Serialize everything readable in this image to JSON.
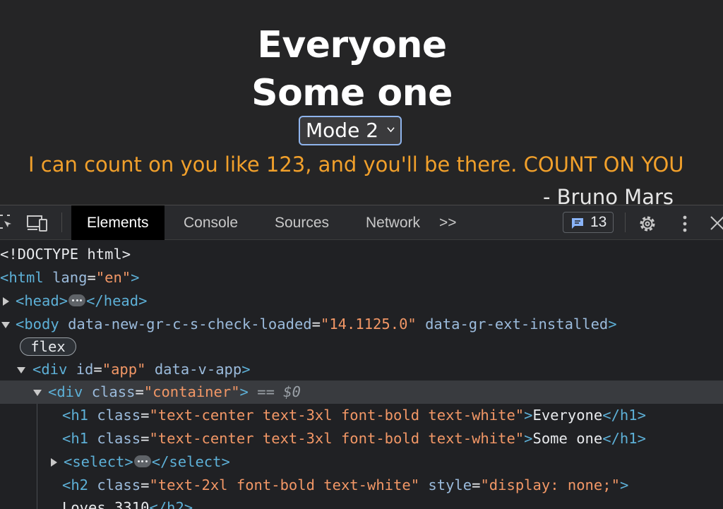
{
  "preview": {
    "heading_1": "Everyone",
    "heading_2": "Some one",
    "select_value": "Mode 2",
    "quote": "I can count on you like 123, and you'll be there. COUNT ON YOU",
    "author": "- Bruno Mars",
    "colors": {
      "quote": "#f1a02b",
      "background": "#252526"
    }
  },
  "devtools": {
    "tabs": [
      "Elements",
      "Console",
      "Sources",
      "Network"
    ],
    "active_tab": "Elements",
    "more_tabs": ">>",
    "issues_count": "13",
    "icons": [
      "inspect-icon",
      "device-toolbar-icon",
      "chat-icon",
      "gear-icon",
      "kebab-menu-icon",
      "close-icon"
    ]
  },
  "tree": {
    "l1": "<!DOCTYPE html>",
    "l2": {
      "open": "<html",
      "attr": "lang",
      "eq": "=",
      "val": "\"en\"",
      "close": ">"
    },
    "l3": {
      "open": "<head>",
      "close": "</head>"
    },
    "l4": {
      "open": "<body",
      "attr1": "data-new-gr-c-s-check-loaded",
      "eq": "=",
      "val1": "\"14.1125.0\"",
      "attr2": "data-gr-ext-installed",
      "close": ">"
    },
    "flex": "flex",
    "l6": {
      "open": "<div",
      "attr1": "id",
      "eq": "=",
      "val1": "\"app\"",
      "attr2": "data-v-app",
      "close": ">"
    },
    "l7": {
      "open": "<div",
      "attr": "class",
      "eq": "=",
      "val": "\"container\"",
      "close": ">",
      "marker": "==",
      "ref": "$0"
    },
    "l8": {
      "open": "<h1",
      "attr": "class",
      "eq": "=",
      "val": "\"text-center text-3xl font-bold text-white\"",
      "gt": ">",
      "text": "Everyone",
      "end": "</h1>"
    },
    "l9": {
      "open": "<h1",
      "attr": "class",
      "eq": "=",
      "val": "\"text-center text-3xl font-bold text-white\"",
      "gt": ">",
      "text": "Some one",
      "end": "</h1>"
    },
    "l10": {
      "open": "<select>",
      "close": "</select>"
    },
    "l11": {
      "open": "<h2",
      "attr1": "class",
      "eq": "=",
      "val1": "\"text-2xl font-bold text-white\"",
      "attr2": "style",
      "val2": "\"display: none;\"",
      "close": ">"
    },
    "l12": {
      "text": "Loves 3310",
      "end": "</h2>"
    }
  }
}
